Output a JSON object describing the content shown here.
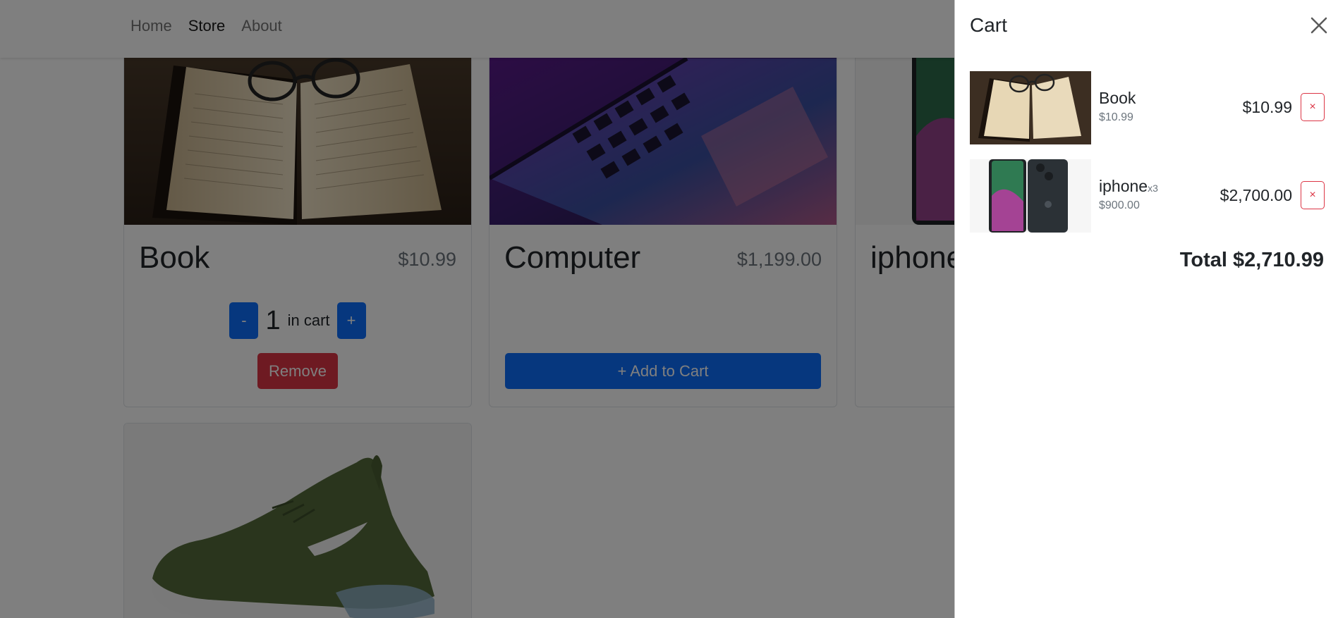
{
  "nav": {
    "links": [
      "Home",
      "Store",
      "About"
    ],
    "active_index": 1
  },
  "store": {
    "items": [
      {
        "name": "Book",
        "price": "$10.99",
        "in_cart": {
          "quantity": "1",
          "label": "in cart",
          "minus": "-",
          "plus": "+",
          "remove": "Remove"
        }
      },
      {
        "name": "Computer",
        "price": "$1,199.00",
        "add_label": "+ Add to Cart"
      },
      {
        "name": "iphone"
      },
      {
        "name": ""
      }
    ]
  },
  "cart": {
    "title": "Cart",
    "close_icon": "close-icon",
    "items": [
      {
        "name": "Book",
        "quantity": "",
        "unit_price": "$10.99",
        "total": "$10.99",
        "remove": "×"
      },
      {
        "name": "iphone",
        "quantity": "x3",
        "unit_price": "$900.00",
        "total": "$2,700.00",
        "remove": "×"
      }
    ],
    "total": "Total $2,710.99"
  },
  "colors": {
    "primary": "#0d6efd",
    "danger": "#dc3545",
    "backdrop": "rgba(0,0,0,0.5)"
  }
}
